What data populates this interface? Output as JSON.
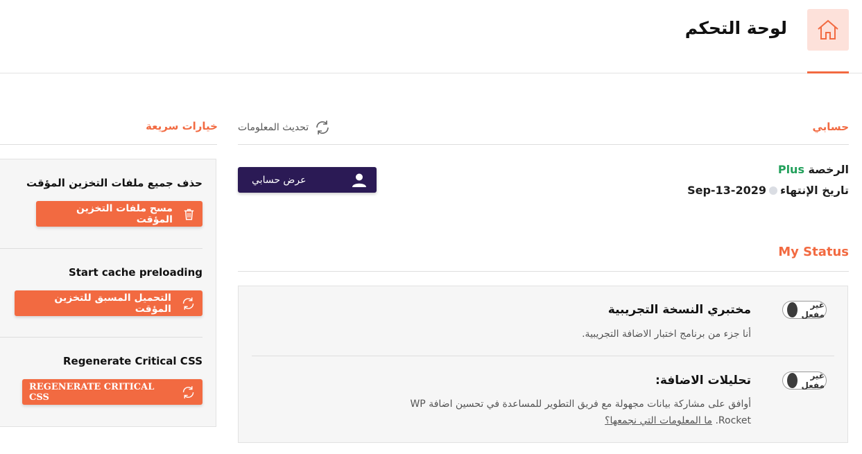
{
  "header": {
    "title": "لوحة التحكم",
    "home_icon": "home-icon"
  },
  "account": {
    "section_title": "حسابي",
    "refresh_label": "تحديث المعلومات",
    "license_label": "الرخصة",
    "license_value": "Plus",
    "expiry_label": "تاريخ الإنتهاء",
    "expiry_value": "Sep-13-2029",
    "view_account_label": "عرض حسابي"
  },
  "status": {
    "section_title": "My Status",
    "options": [
      {
        "title": "مختبري النسخة التجريبية",
        "description": "أنا جزء من برنامج اختبار الاضافة التجريبية.",
        "toggle_label": "غير مفعل"
      },
      {
        "title": "تحليلات الاضافة:",
        "description_line1": "أوافق على مشاركة بيانات مجهولة مع فريق التطوير للمساعدة في تحسين اضافة WP",
        "description_line2": "Rocket.",
        "link": "ما المعلومات التي نجمعها؟",
        "toggle_label": "غير مفعل"
      }
    ]
  },
  "quick": {
    "section_title": "خيارات سريعة",
    "actions": [
      {
        "heading": "حذف جميع ملفات التخزين المؤقت",
        "button": "مسح ملفات التخزين المؤقت",
        "icon": "trash-icon"
      },
      {
        "heading": "Start cache preloading",
        "button": "التحميل المسبق للتخزين المؤقت",
        "icon": "refresh-icon"
      },
      {
        "heading": "Regenerate Critical CSS",
        "button": "REGENERATE CRITICAL CSS",
        "icon": "refresh-icon"
      }
    ]
  },
  "colors": {
    "accent": "#f26a41",
    "dark": "#2b1a55",
    "green": "#22a05b"
  }
}
